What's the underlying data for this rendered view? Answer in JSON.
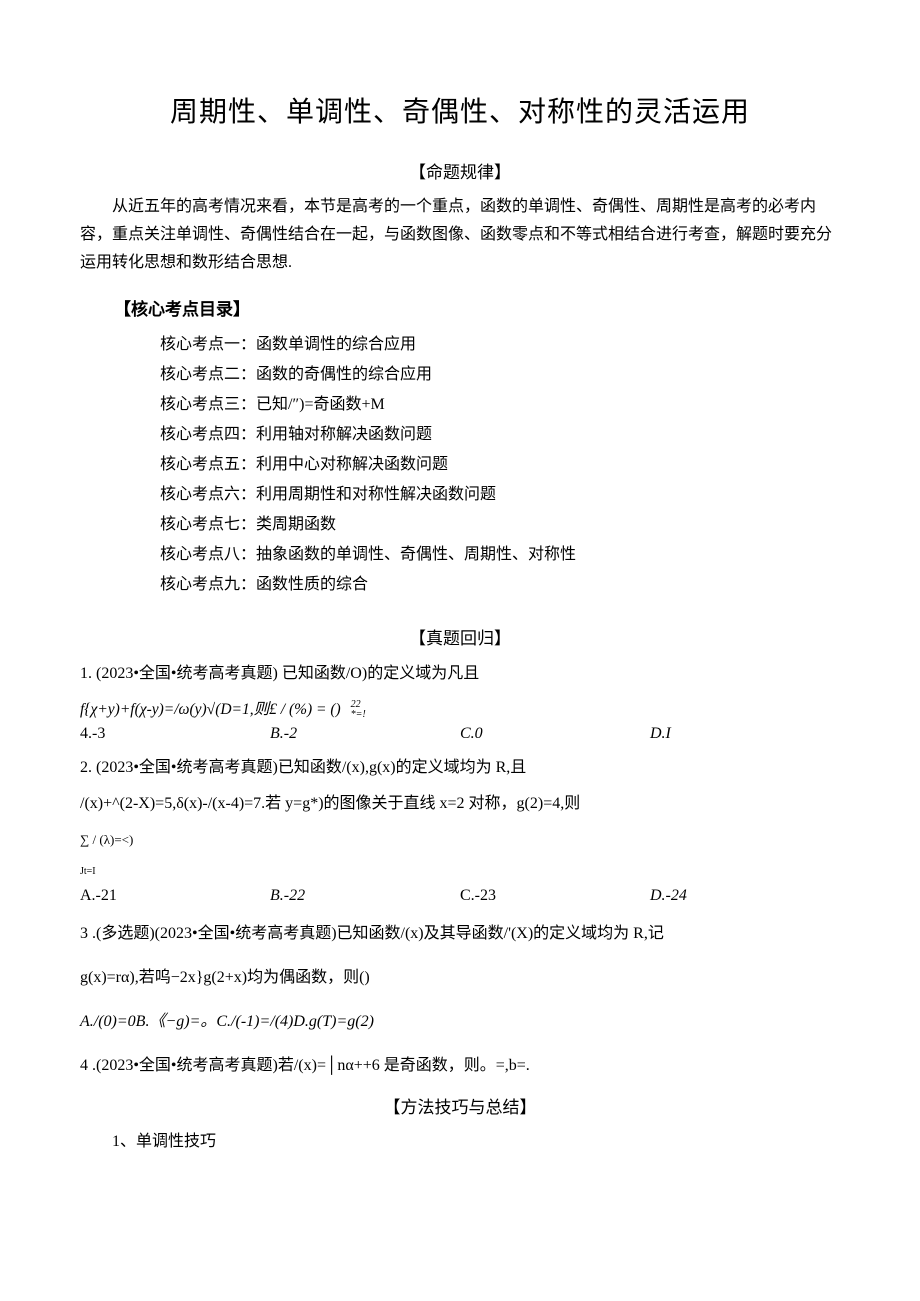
{
  "title": "周期性、单调性、奇偶性、对称性的灵活运用",
  "sections": {
    "prop_head": "【命题规律】",
    "prop_body": "从近五年的高考情况来看，本节是高考的一个重点，函数的单调性、奇偶性、周期性是高考的必考内容，重点关注单调性、奇偶性结合在一起，与函数图像、函数零点和不等式相结合进行考查，解题时要充分运用转化思想和数形结合思想.",
    "core_head": "【核心考点目录】",
    "core_points": [
      "核心考点一：函数单调性的综合应用",
      "核心考点二：函数的奇偶性的综合应用",
      "核心考点三：已知/″)=奇函数+M",
      "核心考点四：利用轴对称解决函数问题",
      "核心考点五：利用中心对称解决函数问题",
      "核心考点六：利用周期性和对称性解决函数问题",
      "核心考点七：类周期函数",
      "核心考点八：抽象函数的单调性、奇偶性、周期性、对称性",
      "核心考点九：函数性质的综合"
    ],
    "recall_head": "【真题回归】",
    "methods_head": "【方法技巧与总结】",
    "methods_1": "1、单调性技巧"
  },
  "questions": {
    "q1": {
      "stem": "1.  (2023•全国•统考高考真题) 已知函数/O)的定义域为凡且",
      "line2_main": "f{χ+y)+f(χ-y)=/ω(y)√(D=1,则£ / (%) = ()",
      "stack_top": "22",
      "stack_bot": "*=!",
      "choices": {
        "A": "4.-3",
        "B": "B.-2",
        "C": "C.0",
        "D": "D.I"
      }
    },
    "q2": {
      "stem": "2.  (2023•全国•统考高考真题)已知函数/(x),g(x)的定义域均为 R,且",
      "line2": "/(x)+^(2-X)=5,δ(x)-/(x-4)=7.若 y=g*)的图像关于直线 x=2 对称，g(2)=4,则",
      "sum_line": "∑ / (λ)=<)",
      "sum_sub": "Jt=I",
      "choices": {
        "A": "A.-21",
        "B": "B.-22",
        "C": "C.-23",
        "D": "D.-24"
      }
    },
    "q3": {
      "stem": "3  .(多选题)(2023•全国•统考高考真题)已知函数/(x)及其导函数/'(X)的定义域均为 R,记",
      "line2": "g(x)=rα),若呜−2x}g(2+x)均为偶函数，则()",
      "line3": "A./(0)=0B.《−g)=。C./(-1)=/(4)D.g(T)=g(2)"
    },
    "q4": {
      "stem": "4  .(2023•全国•统考高考真题)若/(x)=│nα++6 是奇函数，则。=,b=."
    }
  }
}
